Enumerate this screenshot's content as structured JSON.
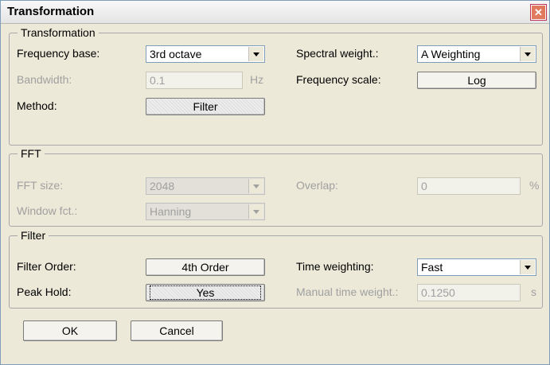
{
  "window": {
    "title": "Transformation"
  },
  "transformation": {
    "legend": "Transformation",
    "frequency_base_label": "Frequency base:",
    "frequency_base_value": "3rd octave",
    "bandwidth_label": "Bandwidth:",
    "bandwidth_value": "0.1",
    "bandwidth_unit": "Hz",
    "method_label": "Method:",
    "method_value": "Filter",
    "spectral_weight_label": "Spectral weight.:",
    "spectral_weight_value": "A Weighting",
    "frequency_scale_label": "Frequency scale:",
    "frequency_scale_value": "Log"
  },
  "fft": {
    "legend": "FFT",
    "size_label": "FFT size:",
    "size_value": "2048",
    "window_label": "Window fct.:",
    "window_value": "Hanning",
    "overlap_label": "Overlap:",
    "overlap_value": "0",
    "overlap_unit": "%"
  },
  "filter": {
    "legend": "Filter",
    "order_label": "Filter Order:",
    "order_value": "4th Order",
    "peak_hold_label": "Peak Hold:",
    "peak_hold_value": "Yes",
    "time_weighting_label": "Time weighting:",
    "time_weighting_value": "Fast",
    "manual_time_label": "Manual time weight.:",
    "manual_time_value": "0.1250",
    "manual_time_unit": "s"
  },
  "buttons": {
    "ok": "OK",
    "cancel": "Cancel"
  },
  "colors": {
    "face": "#ece9d8",
    "border": "#7f9db9",
    "disabled_text": "#a0a0a0",
    "close": "#e07a5f"
  },
  "icons": {
    "close": "close-icon",
    "dropdown": "chevron-down-icon"
  }
}
